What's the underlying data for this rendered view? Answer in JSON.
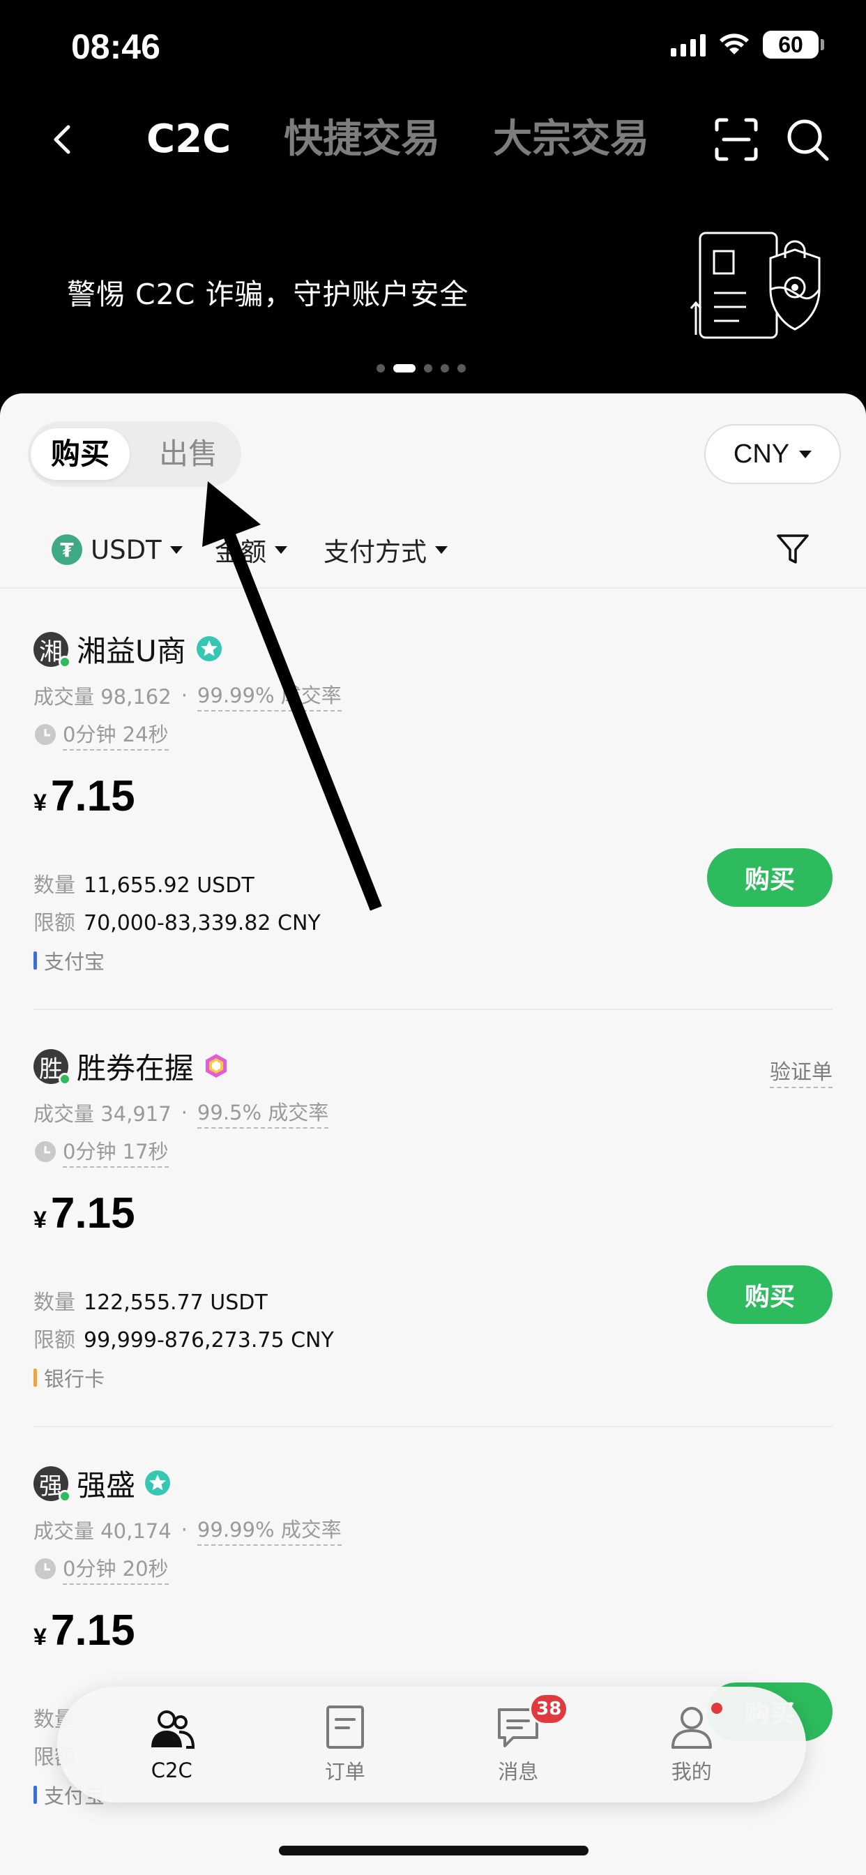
{
  "status_bar": {
    "time": "08:46",
    "battery": "60"
  },
  "nav": {
    "tabs": [
      {
        "label": "C2C",
        "active": true
      },
      {
        "label": "快捷交易",
        "active": false
      },
      {
        "label": "大宗交易",
        "active": false
      }
    ]
  },
  "banner": {
    "text": "警惕 C2C 诈骗，守护账户安全",
    "page_count": 5,
    "active_page": 2
  },
  "trade_toggle": {
    "buy": "购买",
    "sell": "出售",
    "selected": "buy"
  },
  "currency": "CNY",
  "filters": {
    "coin": "USDT",
    "coin_symbol": "₮",
    "amount": "金额",
    "payment": "支付方式"
  },
  "listings": [
    {
      "avatar": "湘",
      "name": "湘益U商",
      "badge": "star",
      "volume": "成交量 98,162",
      "rate": "99.99% 成交率",
      "time": "0分钟 24秒",
      "price_currency": "¥",
      "price": "7.15",
      "quantity_label": "数量",
      "quantity": "11,655.92 USDT",
      "limit_label": "限额",
      "limit": "70,000-83,339.82 CNY",
      "payment": "支付宝",
      "payment_color": "#3b6fd8",
      "button": "购买",
      "verify": ""
    },
    {
      "avatar": "胜",
      "name": "胜券在握",
      "badge": "diamond",
      "volume": "成交量 34,917",
      "rate": "99.5% 成交率",
      "time": "0分钟 17秒",
      "price_currency": "¥",
      "price": "7.15",
      "quantity_label": "数量",
      "quantity": "122,555.77 USDT",
      "limit_label": "限额",
      "limit": "99,999-876,273.75 CNY",
      "payment": "银行卡",
      "payment_color": "#f0a53c",
      "button": "购买",
      "verify": "验证单"
    },
    {
      "avatar": "强",
      "name": "强盛",
      "badge": "star",
      "volume": "成交量 40,174",
      "rate": "99.99% 成交率",
      "time": "0分钟 20秒",
      "price_currency": "¥",
      "price": "7.15",
      "quantity_label": "数量",
      "quantity": "",
      "limit_label": "限额",
      "limit": "",
      "payment": "支付宝",
      "payment_color": "#3b6fd8",
      "button": "购买",
      "verify": ""
    }
  ],
  "tab_bar": [
    {
      "label": "C2C",
      "icon": "users-icon",
      "active": true
    },
    {
      "label": "订单",
      "icon": "order-icon",
      "active": false
    },
    {
      "label": "消息",
      "icon": "message-icon",
      "active": false,
      "badge": "38"
    },
    {
      "label": "我的",
      "icon": "profile-icon",
      "active": false,
      "dot": true
    }
  ],
  "colors": {
    "accent_green": "#2dbb5d",
    "badge_red": "#e03a3e",
    "usdt_green": "#3fa983"
  }
}
